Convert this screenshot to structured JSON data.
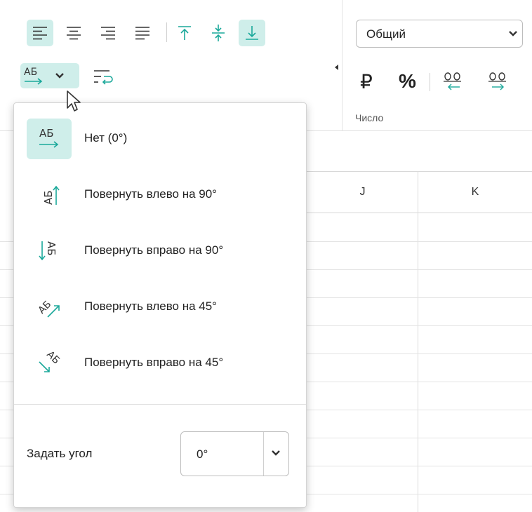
{
  "toolbar": {
    "format_select": {
      "value": "Общий"
    },
    "number_buttons": {
      "currency": "₽",
      "percent": "%"
    },
    "group_label": "Число"
  },
  "sheet": {
    "columns": [
      "J",
      "K"
    ]
  },
  "orientation_menu": {
    "items": [
      {
        "label": "Нет (0°)",
        "icon": "text-horizontal-icon",
        "selected": true
      },
      {
        "label": "Повернуть влево на 90°",
        "icon": "rotate-left-90-icon"
      },
      {
        "label": "Повернуть вправо на 90°",
        "icon": "rotate-right-90-icon"
      },
      {
        "label": "Повернуть влево на 45°",
        "icon": "rotate-left-45-icon"
      },
      {
        "label": "Повернуть вправо на 45°",
        "icon": "rotate-right-45-icon"
      }
    ],
    "angle_label": "Задать угол",
    "angle_value": "0°"
  },
  "icon_text": "АБ",
  "colors": {
    "accent": "#1aa89a",
    "active_bg": "#cfeeea"
  }
}
